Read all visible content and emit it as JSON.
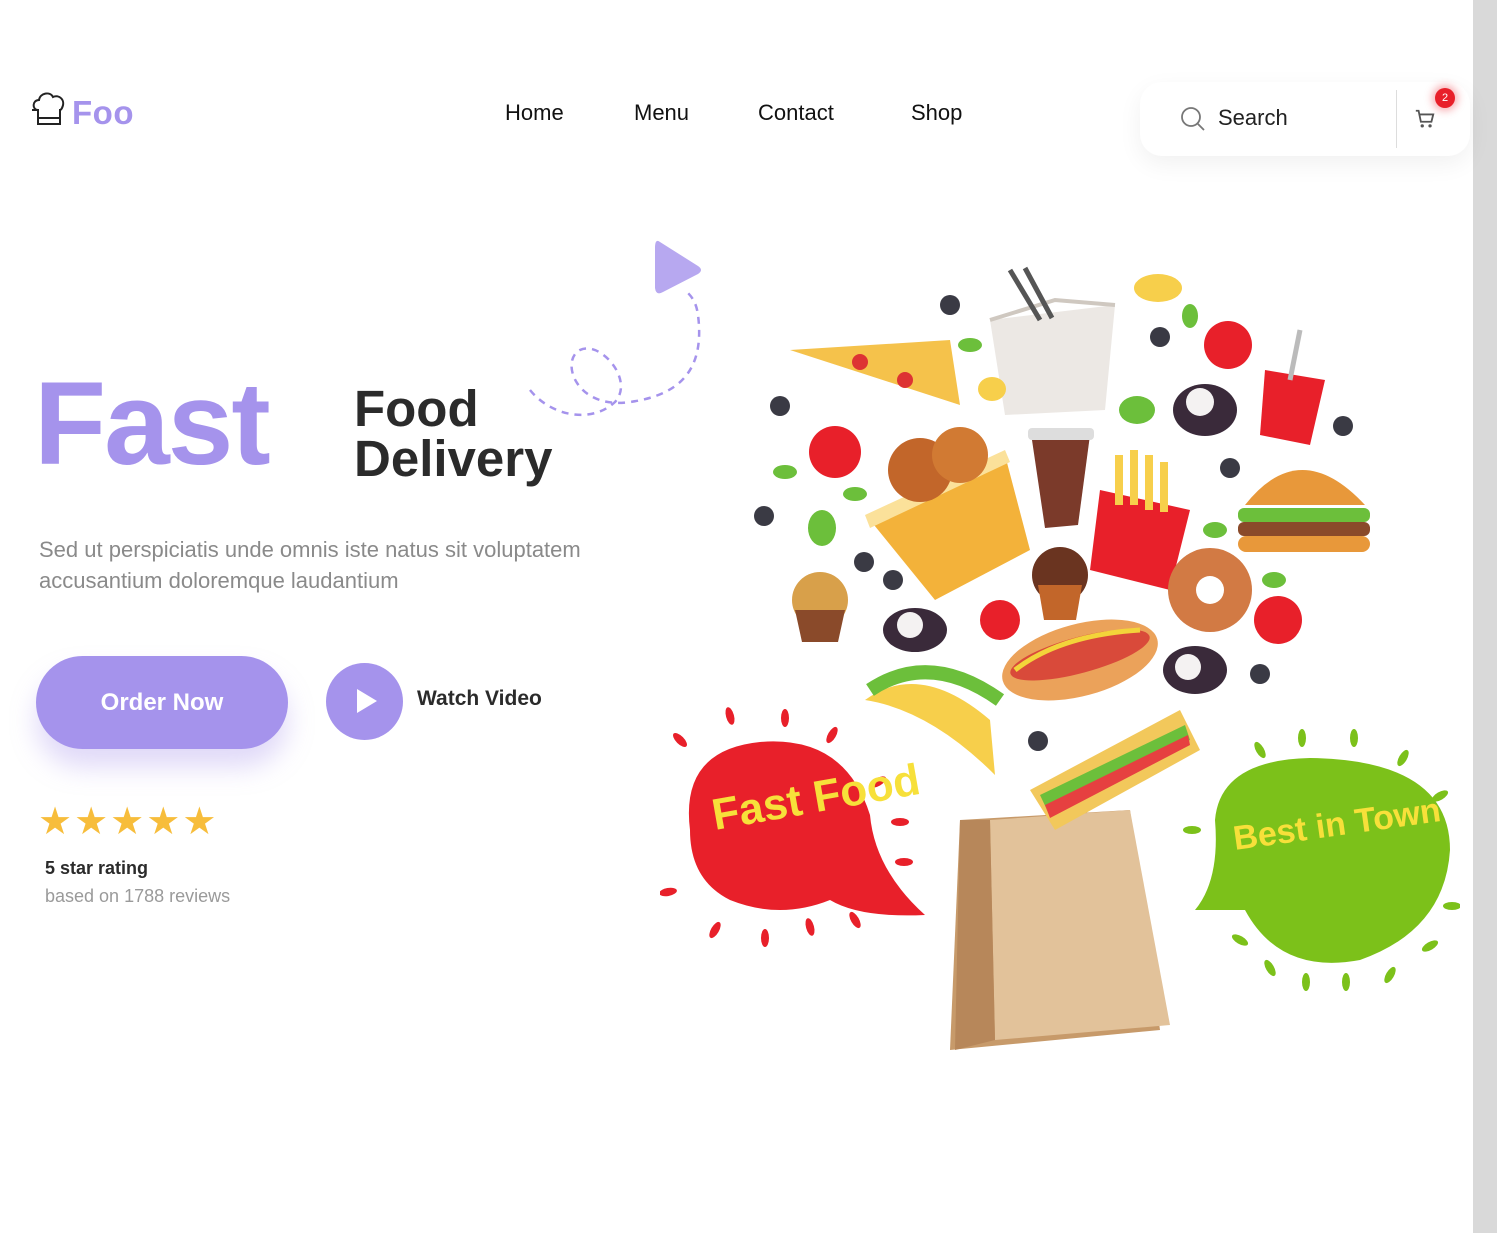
{
  "brand": {
    "name": "Foo",
    "icon": "chef-hat-icon"
  },
  "nav": {
    "items": [
      {
        "label": "Home"
      },
      {
        "label": "Menu"
      },
      {
        "label": "Contact"
      },
      {
        "label": "Shop"
      }
    ]
  },
  "search": {
    "placeholder": "Search",
    "icon": "search-icon"
  },
  "cart": {
    "count": "2",
    "icon": "cart-icon"
  },
  "hero": {
    "title_accent": "Fast",
    "title_line1": "Food",
    "title_line2": "Delivery",
    "description": "Sed ut perspiciatis unde omnis iste natus sit voluptatem accusantium doloremque laudantium",
    "order_label": "Order Now",
    "watch_label": "Watch Video"
  },
  "rating": {
    "stars": 5,
    "title": "5 star rating",
    "subtitle": "based on 1788 reviews"
  },
  "illustration": {
    "badge_left": "Fast Food",
    "badge_right": "Best in Town"
  },
  "colors": {
    "accent": "#a593ec",
    "star": "#f7bd3b",
    "badge": "#e8202a",
    "text_dark": "#2b2b2b",
    "text_muted": "#8a8a8a"
  }
}
